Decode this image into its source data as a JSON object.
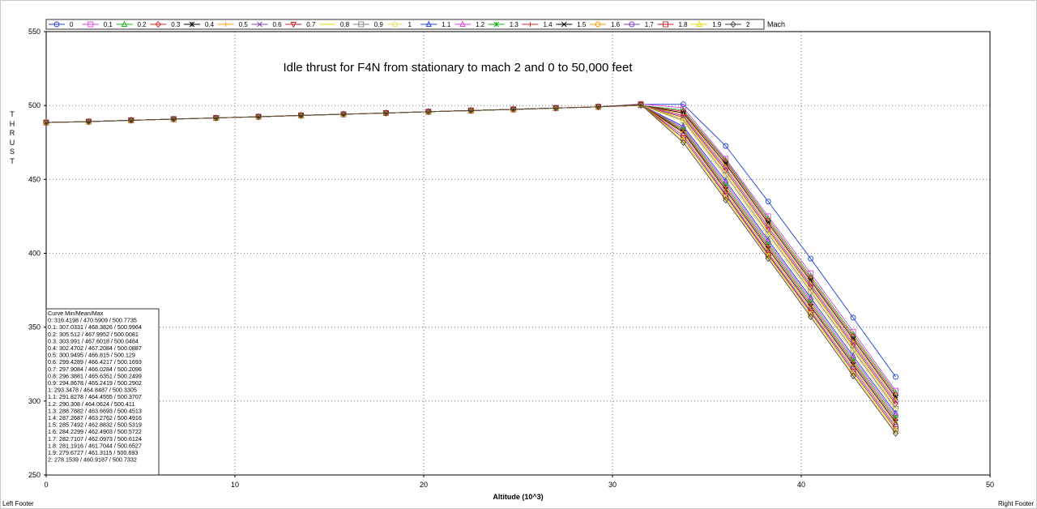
{
  "footer": {
    "left": "Left Footer",
    "right": "Right Footer"
  },
  "chart_data": {
    "type": "line",
    "title": "Idle thrust for F4N from stationary to mach 2 and 0 to 50,000 feet",
    "xlabel": "Altitude (10^3)",
    "ylabel": "THRUST",
    "legend_title": "Mach",
    "legend_position": "top",
    "xlim": [
      0,
      50
    ],
    "ylim": [
      250,
      550
    ],
    "xticks": [
      0,
      10,
      20,
      30,
      40,
      50
    ],
    "yticks": [
      250,
      300,
      350,
      400,
      450,
      500,
      550
    ],
    "grid": true,
    "x": [
      0,
      2.25,
      4.5,
      6.75,
      9,
      11.25,
      13.5,
      15.75,
      18,
      20.25,
      22.5,
      24.75,
      27,
      29.25,
      31.5,
      33.75,
      36,
      38.25,
      40.5,
      42.75,
      45
    ],
    "series": [
      {
        "name": "0",
        "color": "#1f3fd6",
        "marker": "circle",
        "values": [
          488.5,
          489.1,
          490,
          490.8,
          491.6,
          492.4,
          493.3,
          494.1,
          494.9,
          495.8,
          496.6,
          497.4,
          498.3,
          499.1,
          500.8,
          500.8,
          472.6,
          435,
          396.4,
          356.4,
          316.4
        ]
      },
      {
        "name": "0.1",
        "color": "#e040e0",
        "marker": "square",
        "values": [
          488.5,
          489.1,
          490,
          490.8,
          491.6,
          492.4,
          493.3,
          494.1,
          494.9,
          495.8,
          496.6,
          497.4,
          498.3,
          499.1,
          501,
          498.5,
          464,
          425,
          386.5,
          347,
          307
        ]
      },
      {
        "name": "0.2",
        "color": "#15b015",
        "marker": "triangle",
        "values": [
          488.5,
          489.1,
          490,
          490.8,
          491.6,
          492.4,
          493.3,
          494.1,
          494.9,
          495.8,
          496.6,
          497.4,
          498.3,
          499.1,
          500,
          497,
          463,
          423.5,
          384.5,
          345,
          305.5
        ]
      },
      {
        "name": "0.3",
        "color": "#e02020",
        "marker": "diamond",
        "values": [
          488.5,
          489.1,
          490,
          490.8,
          491.6,
          492.4,
          493.3,
          494.1,
          494.9,
          495.8,
          496.6,
          497.4,
          498.3,
          499.1,
          500,
          496,
          462,
          422,
          383,
          343.5,
          304
        ]
      },
      {
        "name": "0.4",
        "color": "#000000",
        "marker": "star",
        "values": [
          488.5,
          489.1,
          490,
          490.8,
          491.6,
          492.4,
          493.3,
          494.1,
          494.9,
          495.8,
          496.6,
          497.4,
          498.3,
          499.1,
          500.1,
          495,
          460.5,
          420.5,
          381.5,
          342,
          302.5
        ]
      },
      {
        "name": "0.5",
        "color": "#ff9900",
        "marker": "plus",
        "values": [
          488.5,
          489.1,
          490,
          490.8,
          491.6,
          492.4,
          493.3,
          494.1,
          494.9,
          495.8,
          496.6,
          497.4,
          498.3,
          499.1,
          500.1,
          494,
          459,
          419,
          380,
          340.5,
          301
        ]
      },
      {
        "name": "0.6",
        "color": "#8040c0",
        "marker": "x",
        "values": [
          488.5,
          489.1,
          490,
          490.8,
          491.6,
          492.4,
          493.3,
          494.1,
          494.9,
          495.8,
          496.6,
          497.4,
          498.3,
          499.1,
          500.2,
          493,
          457.5,
          417.5,
          378.5,
          339,
          299.5
        ]
      },
      {
        "name": "0.7",
        "color": "#c02020",
        "marker": "triangle-down",
        "values": [
          488.5,
          489.1,
          490,
          490.8,
          491.6,
          492.4,
          493.3,
          494.1,
          494.9,
          495.8,
          496.6,
          497.4,
          498.3,
          499.1,
          500.2,
          492,
          456,
          416,
          377,
          337.5,
          298
        ]
      },
      {
        "name": "0.8",
        "color": "#e8d800",
        "marker": "hline",
        "values": [
          488.5,
          489.1,
          490,
          490.8,
          491.6,
          492.4,
          493.3,
          494.1,
          494.9,
          495.8,
          496.6,
          497.4,
          498.3,
          499.1,
          500.2,
          491,
          454.5,
          414.5,
          375.5,
          336,
          296.5
        ]
      },
      {
        "name": "0.9",
        "color": "#808080",
        "marker": "square",
        "values": [
          488.5,
          489.1,
          490,
          490.8,
          491.6,
          492.4,
          493.3,
          494.1,
          494.9,
          495.8,
          496.6,
          497.4,
          498.3,
          499.1,
          500.3,
          490,
          453,
          413,
          374,
          334.5,
          295
        ]
      },
      {
        "name": "1",
        "color": "#f0e060",
        "marker": "circle",
        "values": [
          488.5,
          489.1,
          490,
          490.8,
          491.6,
          492.4,
          493.3,
          494.1,
          494.9,
          495.8,
          496.6,
          497.4,
          498.3,
          499.1,
          500.3,
          489,
          451.5,
          411.5,
          372.5,
          333,
          293.5
        ]
      },
      {
        "name": "1.1",
        "color": "#2040e0",
        "marker": "triangle",
        "values": [
          488.5,
          489.1,
          490,
          490.8,
          491.6,
          492.4,
          493.3,
          494.1,
          494.9,
          495.8,
          496.6,
          497.4,
          498.3,
          499.1,
          500.4,
          486,
          449,
          409,
          370,
          330.5,
          291.8
        ]
      },
      {
        "name": "1.2",
        "color": "#e040e0",
        "marker": "triangle",
        "values": [
          488.5,
          489.1,
          490,
          490.8,
          491.6,
          492.4,
          493.3,
          494.1,
          494.9,
          495.8,
          496.6,
          497.4,
          498.3,
          499.1,
          500.4,
          485,
          447.5,
          407.5,
          368.5,
          329,
          290.3
        ]
      },
      {
        "name": "1.3",
        "color": "#15b015",
        "marker": "star",
        "values": [
          488.5,
          489.1,
          490,
          490.8,
          491.6,
          492.4,
          493.3,
          494.1,
          494.9,
          495.8,
          496.6,
          497.4,
          498.3,
          499.1,
          500.5,
          484,
          446,
          406,
          367,
          327.5,
          288.8
        ]
      },
      {
        "name": "1.4",
        "color": "#e02020",
        "marker": "plus",
        "values": [
          488.5,
          489.1,
          490,
          490.8,
          491.6,
          492.4,
          493.3,
          494.1,
          494.9,
          495.8,
          496.6,
          497.4,
          498.3,
          499.1,
          500.5,
          483,
          444.5,
          404.5,
          365.5,
          326,
          287.3
        ]
      },
      {
        "name": "1.5",
        "color": "#000000",
        "marker": "x",
        "values": [
          488.5,
          489.1,
          490,
          490.8,
          491.6,
          492.4,
          493.3,
          494.1,
          494.9,
          495.8,
          496.6,
          497.4,
          498.3,
          499.1,
          500.5,
          482,
          443,
          403,
          364,
          324.5,
          285.7
        ]
      },
      {
        "name": "1.6",
        "color": "#ff9900",
        "marker": "circle",
        "values": [
          488.5,
          489.1,
          490,
          490.8,
          491.6,
          492.4,
          493.3,
          494.1,
          494.9,
          495.8,
          496.6,
          497.4,
          498.3,
          499.1,
          500.6,
          481,
          441.5,
          401.5,
          362.5,
          323,
          284.2
        ]
      },
      {
        "name": "1.7",
        "color": "#8040c0",
        "marker": "circle",
        "values": [
          488.5,
          489.1,
          490,
          490.8,
          491.6,
          492.4,
          493.3,
          494.1,
          494.9,
          495.8,
          496.6,
          497.4,
          498.3,
          499.1,
          500.6,
          479.5,
          440,
          400,
          361,
          321.5,
          282.7
        ]
      },
      {
        "name": "1.8",
        "color": "#c02020",
        "marker": "square",
        "values": [
          488.5,
          489.1,
          490,
          490.8,
          491.6,
          492.4,
          493.3,
          494.1,
          494.9,
          495.8,
          496.6,
          497.4,
          498.3,
          499.1,
          500.7,
          478,
          439,
          399,
          360,
          320,
          281.2
        ]
      },
      {
        "name": "1.9",
        "color": "#e8d800",
        "marker": "triangle",
        "values": [
          488.5,
          489.1,
          490,
          490.8,
          491.6,
          492.4,
          493.3,
          494.1,
          494.9,
          495.8,
          496.6,
          497.4,
          498.3,
          499.1,
          500.7,
          476.5,
          437.5,
          398,
          358.5,
          318.5,
          279.7
        ]
      },
      {
        "name": "2",
        "color": "#404040",
        "marker": "diamond",
        "values": [
          488.5,
          489.1,
          490,
          490.8,
          491.6,
          492.4,
          493.3,
          494.1,
          494.9,
          495.8,
          496.6,
          497.4,
          498.3,
          499.1,
          500.7,
          475,
          436,
          396.5,
          357,
          317,
          278.2
        ]
      }
    ],
    "stats_box": {
      "header": "Curve Min/Mean/Max",
      "lines": [
        "0: 316.4198 / 470.5909 / 500.7735",
        "0.1: 307.0331 / 468.3826 / 500.9964",
        "0.2: 305.512 / 467.9952 / 500.0081",
        "0.3: 303.991 / 467.6018 / 500.0484",
        "0.4: 302.4702 / 467.2084 / 500.0887",
        "0.5: 300.9495 / 466.815 / 500.129",
        "0.6: 299.4289 / 466.4217 / 500.1693",
        "0.7: 297.9084 / 466.0284 / 500.2096",
        "0.8: 296.3881 / 465.6351 / 500.2499",
        "0.9: 294.8678 / 465.2419 / 500.2902",
        "1: 293.3478 / 464.8487 / 500.3305",
        "1.1: 291.8278 / 464.4555 / 500.3707",
        "1.2: 290.308 / 464.0624 / 500.411",
        "1.3: 288.7882 / 463.6693 / 500.4513",
        "1.4: 287.2687 / 463.2762 / 500.4916",
        "1.5: 285.7492 / 462.8832 / 500.5319",
        "1.6: 284.2299 / 462.4903 / 500.5722",
        "1.7: 282.7107 / 462.0973 / 500.6124",
        "1.8: 281.1916 / 461.7044 / 500.6527",
        "1.9: 279.6727 / 461.3115 / 500.693",
        "2: 278.1539 / 460.9187 / 500.7332"
      ]
    }
  }
}
